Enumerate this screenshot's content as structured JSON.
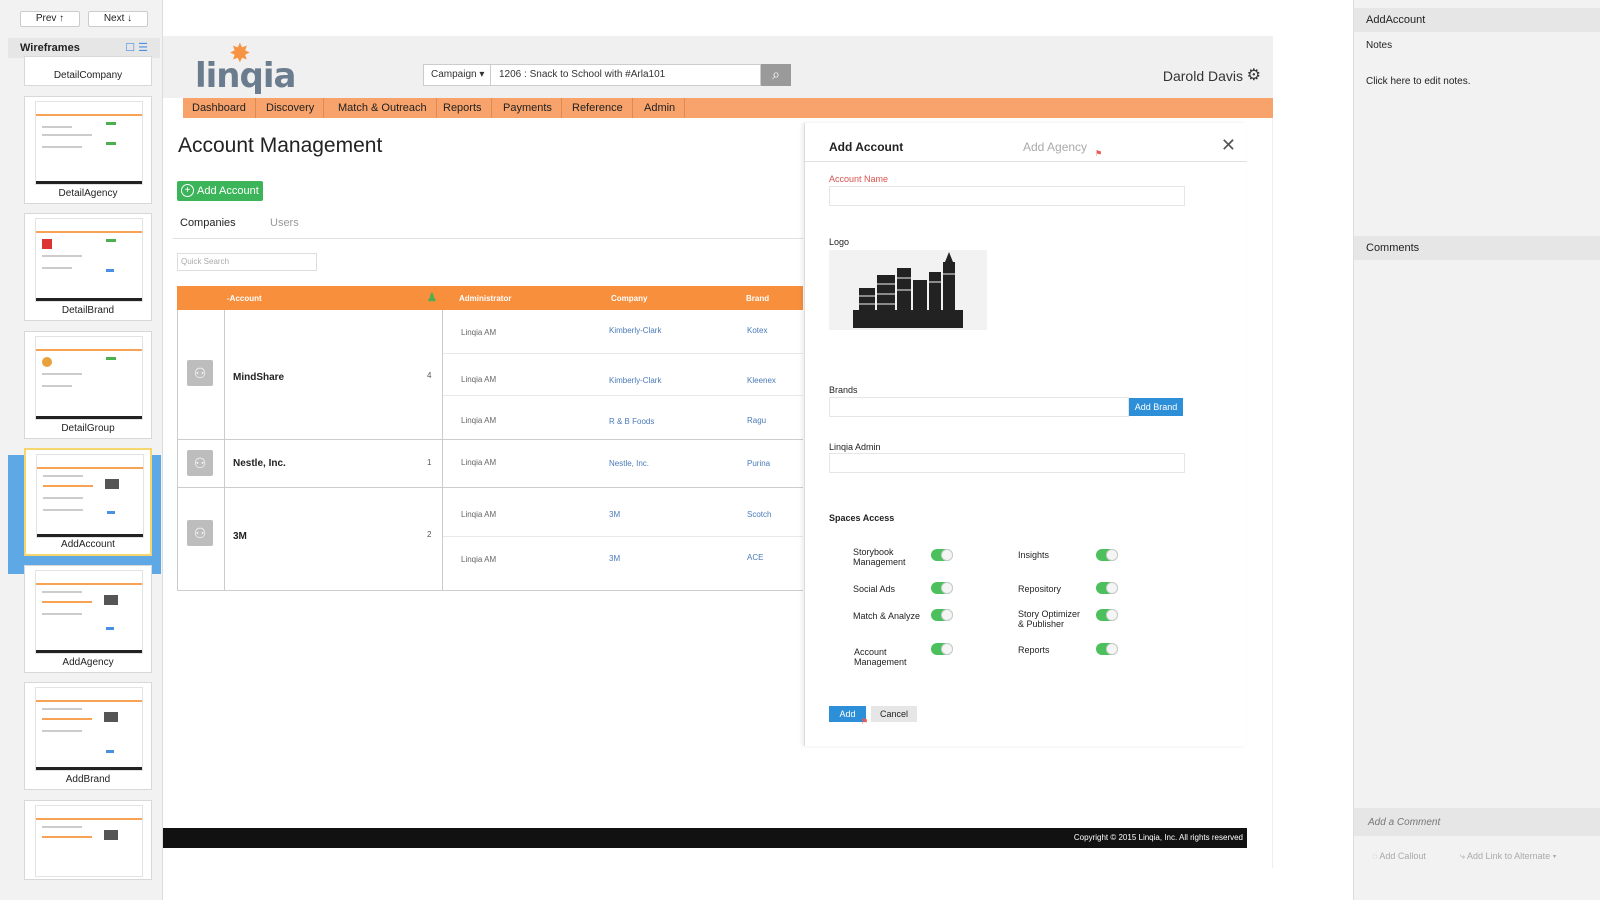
{
  "left_panel": {
    "prev_label": "Prev ↑",
    "next_label": "Next ↓",
    "section_title": "Wireframes",
    "thumbnails": [
      {
        "name": "DetailCompany"
      },
      {
        "name": "DetailAgency"
      },
      {
        "name": "DetailBrand"
      },
      {
        "name": "DetailGroup"
      },
      {
        "name": "AddAccount"
      },
      {
        "name": "AddAgency"
      },
      {
        "name": "AddBrand"
      }
    ]
  },
  "app": {
    "logo_text": "linqia",
    "campaign_select": "Campaign ▾",
    "campaign_value": "1206 : Snack to School with #Arla101",
    "user_name": "Darold Davis",
    "nav": [
      "Dashboard",
      "Discovery",
      "Match & Outreach",
      "Reports",
      "Payments",
      "Reference",
      "Admin"
    ],
    "page_title": "Account Management",
    "add_account_label": "Add Account",
    "tabs": [
      "Companies",
      "Users"
    ],
    "quick_search_placeholder": "Quick Search",
    "table": {
      "headers": [
        "-Account",
        "Administrator",
        "Company",
        "Brand"
      ],
      "groups": [
        {
          "name": "MindShare",
          "count": "4",
          "rows": [
            {
              "admin": "Linqia AM",
              "company": "Kimberly-Clark",
              "brand": "Kotex"
            },
            {
              "admin": "Linqia AM",
              "company": "Kimberly-Clark",
              "brand": "Kleenex"
            },
            {
              "admin": "Linqia AM",
              "company": "R & B Foods",
              "brand": "Ragu"
            }
          ]
        },
        {
          "name": "Nestle, Inc.",
          "count": "1",
          "rows": [
            {
              "admin": "Linqia AM",
              "company": "Nestle, Inc.",
              "brand": "Purina"
            }
          ]
        },
        {
          "name": "3M",
          "count": "2",
          "rows": [
            {
              "admin": "Linqia AM",
              "company": "3M",
              "brand": "Scotch"
            },
            {
              "admin": "Linqia AM",
              "company": "3M",
              "brand": "ACE"
            }
          ]
        }
      ]
    },
    "footer": "Copyright © 2015 Linqia, Inc. All rights reserved"
  },
  "modal": {
    "title": "Add Account",
    "tab2": "Add Agency",
    "account_name_label": "Account Name",
    "logo_label": "Logo",
    "brands_label": "Brands",
    "add_brand_label": "Add Brand",
    "linqia_admin_label": "Linqia Admin",
    "spaces_title": "Spaces Access",
    "spaces": [
      {
        "label": "Storybook\nManagement",
        "on": true
      },
      {
        "label": "Insights",
        "on": true
      },
      {
        "label": "Social Ads",
        "on": true
      },
      {
        "label": "Repository",
        "on": true
      },
      {
        "label": "Match & Analyze",
        "on": true
      },
      {
        "label": "Story Optimizer\n& Publisher",
        "on": true
      },
      {
        "label": "Account\nManagement",
        "on": true
      },
      {
        "label": "Reports",
        "on": true
      }
    ],
    "add_label": "Add",
    "cancel_label": "Cancel"
  },
  "right_panel": {
    "title": "AddAccount",
    "notes_label": "Notes",
    "notes_text": "Click here to edit notes.",
    "comments_label": "Comments",
    "add_comment": "Add a Comment",
    "add_callout": "Add Callout",
    "add_link": "Add Link to Alternate ▾"
  },
  "colors": {
    "accent_orange": "#f78f3d",
    "nav_orange": "#f7a36b",
    "green": "#3cb55a",
    "blue": "#2d8fd8",
    "selected_thumb": "#5fa8e6"
  }
}
